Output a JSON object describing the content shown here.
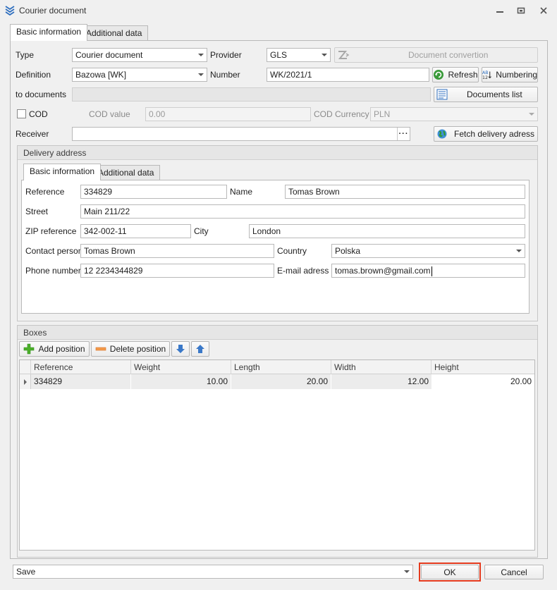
{
  "window": {
    "title": "Courier document"
  },
  "tabs": [
    "Basic information",
    "Additional data"
  ],
  "form": {
    "type_label": "Type",
    "type_value": "Courier document",
    "provider_label": "Provider",
    "provider_value": "GLS",
    "doc_conv_label": "Document convertion",
    "definition_label": "Definition",
    "definition_value": "Bazowa [WK]",
    "number_label": "Number",
    "number_value": "WK/2021/1",
    "refresh_label": "Refresh",
    "numbering_label": "Numbering",
    "to_docs_label": "to documents",
    "to_docs_value": "",
    "documents_list_label": "Documents list",
    "cod_label": "COD",
    "cod_value_label": "COD value",
    "cod_value": "0.00",
    "cod_currency_label": "COD Currency",
    "cod_currency_value": "PLN",
    "receiver_label": "Receiver",
    "receiver_value": "",
    "fetch_label": "Fetch delivery adress"
  },
  "delivery": {
    "group_title": "Delivery address",
    "tabs": [
      "Basic information",
      "Additional data"
    ],
    "reference_label": "Reference",
    "reference_value": "334829",
    "name_label": "Name",
    "name_value": "Tomas Brown",
    "street_label": "Street",
    "street_value": "Main 211/22",
    "zip_label": "ZIP reference",
    "zip_value": "342-002-11",
    "city_label": "City",
    "city_value": "London",
    "contact_label": "Contact person",
    "contact_value": "Tomas Brown",
    "country_label": "Country",
    "country_value": "Polska",
    "phone_label": "Phone number",
    "phone_value": "12 2234344829",
    "email_label": "E-mail adress",
    "email_value": "tomas.brown@gmail.com"
  },
  "boxes": {
    "group_title": "Boxes",
    "add_label": "Add position",
    "delete_label": "Delete position",
    "columns": [
      "Reference",
      "Weight",
      "Length",
      "Width",
      "Height"
    ],
    "rows": [
      [
        "334829",
        "10.00",
        "20.00",
        "12.00",
        "20.00"
      ]
    ]
  },
  "footer": {
    "action_value": "Save",
    "ok_label": "OK",
    "cancel_label": "Cancel"
  },
  "colors": {
    "ok_highlight": "#e53b1e",
    "accent": "#2f6fbf"
  }
}
